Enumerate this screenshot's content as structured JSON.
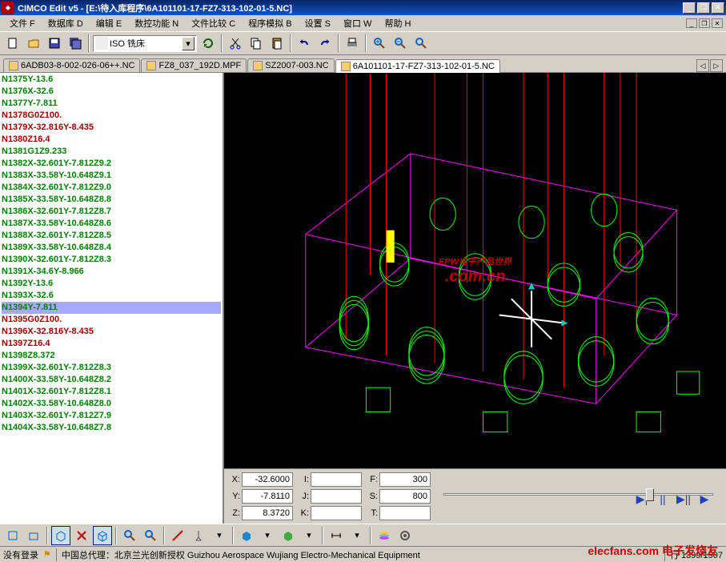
{
  "window": {
    "title": "CIMCO Edit v5 - [E:\\待入库程序\\6A101101-17-FZ7-313-102-01-5.NC]"
  },
  "menu": {
    "file": "文件 F",
    "db": "数据库 D",
    "edit": "编辑 E",
    "nc": "数控功能 N",
    "compare": "文件比较 C",
    "sim": "程序模拟 B",
    "setup": "设置 S",
    "window": "窗口 W",
    "help": "帮助 H"
  },
  "combo": {
    "machine": "ISO 铣床"
  },
  "tabs": [
    {
      "label": "6ADB03-8-002-026-06++.NC",
      "active": false
    },
    {
      "label": "FZ8_037_192D.MPF",
      "active": false
    },
    {
      "label": "SZ2007-003.NC",
      "active": false
    },
    {
      "label": "6A101101-17-FZ7-313-102-01-5.NC",
      "active": true
    }
  ],
  "code": [
    {
      "t": "N1375Y-13.6",
      "c": "green"
    },
    {
      "t": "N1376X-32.6",
      "c": "green"
    },
    {
      "t": "N1377Y-7.811",
      "c": "green"
    },
    {
      "t": "N1378G0Z100.",
      "c": "red"
    },
    {
      "t": "N1379X-32.816Y-8.435",
      "c": "red"
    },
    {
      "t": "N1380Z16.4",
      "c": "red"
    },
    {
      "t": "N1381G1Z9.233",
      "c": "green"
    },
    {
      "t": "N1382X-32.601Y-7.812Z9.2",
      "c": "green"
    },
    {
      "t": "N1383X-33.58Y-10.648Z9.1",
      "c": "green"
    },
    {
      "t": "N1384X-32.601Y-7.812Z9.0",
      "c": "green"
    },
    {
      "t": "N1385X-33.58Y-10.648Z8.8",
      "c": "green"
    },
    {
      "t": "N1386X-32.601Y-7.812Z8.7",
      "c": "green"
    },
    {
      "t": "N1387X-33.58Y-10.648Z8.6",
      "c": "green"
    },
    {
      "t": "N1388X-32.601Y-7.812Z8.5",
      "c": "green"
    },
    {
      "t": "N1389X-33.58Y-10.648Z8.4",
      "c": "green"
    },
    {
      "t": "N1390X-32.601Y-7.812Z8.3",
      "c": "green"
    },
    {
      "t": "N1391X-34.6Y-8.966",
      "c": "green"
    },
    {
      "t": "N1392Y-13.6",
      "c": "green"
    },
    {
      "t": "N1393X-32.6",
      "c": "green"
    },
    {
      "t": "N1394Y-7.811",
      "c": "green",
      "sel": true
    },
    {
      "t": "N1395G0Z100.",
      "c": "red"
    },
    {
      "t": "N1396X-32.816Y-8.435",
      "c": "red"
    },
    {
      "t": "N1397Z16.4",
      "c": "red"
    },
    {
      "t": "N1398Z8.372",
      "c": "green"
    },
    {
      "t": "N1399X-32.601Y-7.812Z8.3",
      "c": "green"
    },
    {
      "t": "N1400X-33.58Y-10.648Z8.2",
      "c": "green"
    },
    {
      "t": "N1401X-32.601Y-7.812Z8.1",
      "c": "green"
    },
    {
      "t": "N1402X-33.58Y-10.648Z8.0",
      "c": "green"
    },
    {
      "t": "N1403X-32.601Y-7.812Z7.9",
      "c": "green"
    },
    {
      "t": "N1404X-33.58Y-10.648Z7.8",
      "c": "green"
    }
  ],
  "coords": {
    "xl": "X:",
    "x": "-32.6000",
    "il": "I:",
    "i": "",
    "fl": "F:",
    "f": "300",
    "yl": "Y:",
    "y": "-7.8110",
    "jl": "J:",
    "j": "",
    "sl": "S:",
    "s": "800",
    "zl": "Z:",
    "z": "8.3720",
    "kl": "K:",
    "k": "",
    "tl": "T:",
    "t": ""
  },
  "status": {
    "login": "没有登录",
    "agent": "中国总代理：北京兰光创新授权 Guizhou Aerospace Wujiang Electro-Mechanical Equipment",
    "pos": "行 1399/1507"
  },
  "watermark": {
    "main": "EPW电子产品世界",
    "sub": ".com.cn"
  },
  "brand": "elecfans.com 电子发烧友"
}
